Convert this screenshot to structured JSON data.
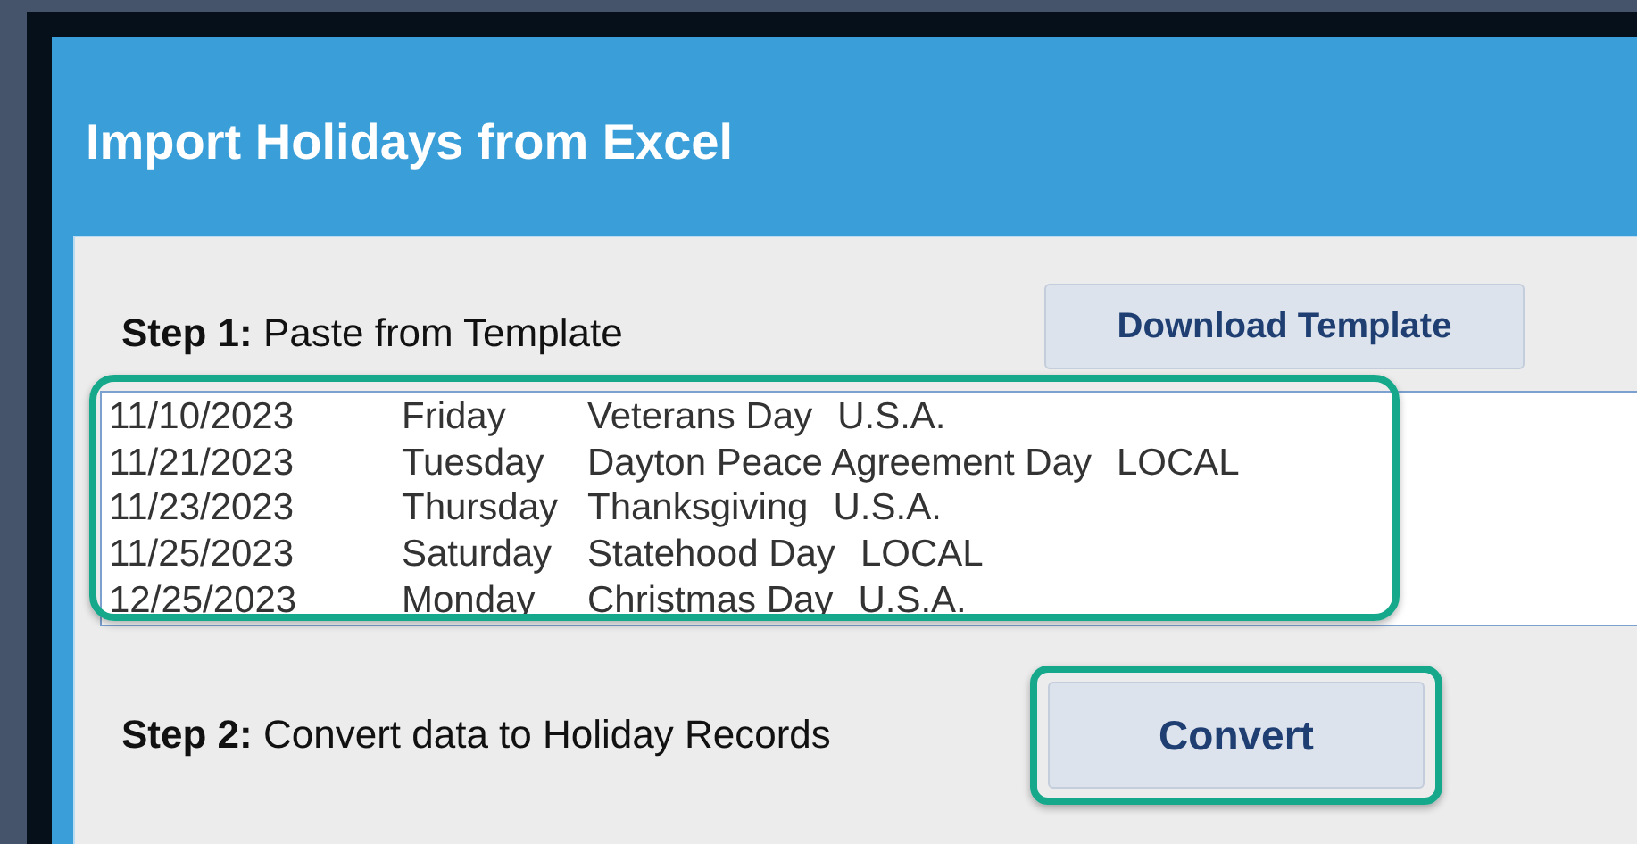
{
  "dialog": {
    "title": "Import Holidays from Excel"
  },
  "step_1": {
    "label_bold": "Step 1:",
    "label": "Paste from Template",
    "button": "Download Template"
  },
  "paste_area": {
    "highlighted": true,
    "lines": [
      {
        "date": "11/10/2023",
        "day": "Friday",
        "name": "Veterans Day",
        "region": "U.S.A."
      },
      {
        "date": "11/21/2023",
        "day": "Tuesday",
        "name": "Dayton Peace Agreement Day",
        "region": "LOCAL"
      },
      {
        "date": "11/23/2023",
        "day": "Thursday",
        "name": "Thanksgiving",
        "region": "U.S.A."
      },
      {
        "date": "11/25/2023",
        "day": "Saturday",
        "name": "Statehood Day",
        "region": "LOCAL"
      },
      {
        "date": "12/25/2023",
        "day": "Monday",
        "name": "Christmas Day",
        "region": "U.S.A."
      }
    ]
  },
  "step_2": {
    "label_bold": "Step 2:",
    "label": "Convert data to Holiday Records",
    "button": "Convert",
    "highlighted": true
  }
}
